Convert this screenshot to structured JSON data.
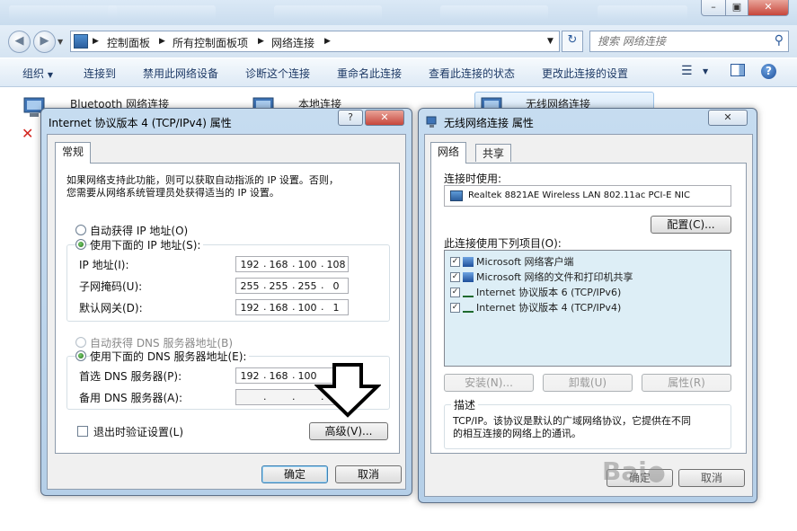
{
  "address": {
    "crumbs": [
      "控制面板",
      "所有控制面板项",
      "网络连接"
    ],
    "search_placeholder": "搜索 网络连接"
  },
  "commands": {
    "organize": "组织",
    "connect_to": "连接到",
    "disable": "禁用此网络设备",
    "diagnose": "诊断这个连接",
    "rename": "重命名此连接",
    "view_status": "查看此连接的状态",
    "change_settings": "更改此连接的设置"
  },
  "connections": [
    {
      "label": "Bluetooth 网络连接"
    },
    {
      "label": "本地连接"
    },
    {
      "label": "无线网络连接"
    }
  ],
  "ipv4_dialog": {
    "title": "Internet 协议版本 4 (TCP/IPv4) 属性",
    "tab": "常规",
    "intro_line1": "如果网络支持此功能，则可以获取自动指派的 IP 设置。否则，",
    "intro_line2": "您需要从网络系统管理员处获得适当的 IP 设置。",
    "auto_ip": "自动获得 IP 地址(O)",
    "manual_ip": "使用下面的 IP 地址(S):",
    "ip_label": "IP 地址(I):",
    "ip_octets": [
      "192",
      "168",
      "100",
      "108"
    ],
    "mask_label": "子网掩码(U):",
    "mask_octets": [
      "255",
      "255",
      "255",
      "0"
    ],
    "gateway_label": "默认网关(D):",
    "gateway_octets": [
      "192",
      "168",
      "100",
      "1"
    ],
    "auto_dns": "自动获得 DNS 服务器地址(B)",
    "manual_dns": "使用下面的 DNS 服务器地址(E):",
    "pref_dns_label": "首选 DNS 服务器(P):",
    "pref_dns_octets": [
      "192",
      "168",
      "100",
      ""
    ],
    "alt_dns_label": "备用 DNS 服务器(A):",
    "validate": "退出时验证设置(L)",
    "advanced": "高级(V)...",
    "ok": "确定",
    "cancel": "取消",
    "help_glyph": "?",
    "close_glyph": "✕"
  },
  "wireless_dialog": {
    "title": "无线网络连接 属性",
    "tab_network": "网络",
    "tab_share": "共享",
    "connect_using": "连接时使用:",
    "adapter": "Realtek 8821AE Wireless LAN 802.11ac PCI-E NIC",
    "configure": "配置(C)...",
    "items_label": "此连接使用下列项目(O):",
    "items": [
      {
        "label": "Microsoft 网络客户端",
        "checked": true
      },
      {
        "label": "Microsoft 网络的文件和打印机共享",
        "checked": true
      },
      {
        "label": "Internet 协议版本 6 (TCP/IPv6)",
        "checked": true
      },
      {
        "label": "Internet 协议版本 4 (TCP/IPv4)",
        "checked": true
      }
    ],
    "install": "安装(N)...",
    "uninstall": "卸载(U)",
    "properties": "属性(R)",
    "desc_title": "描述",
    "desc_line1": "TCP/IP。该协议是默认的广域网络协议，它提供在不同",
    "desc_line2": "的相互连接的网络上的通讯。",
    "ok_partial": "确定",
    "cancel_partial": "取消",
    "close_glyph": "✕"
  },
  "colors": {
    "accent": "#1e3a66",
    "dialog_frame": "#b5cfe8",
    "close_red": "#c7463b"
  },
  "icons": [
    "back-arrow-icon",
    "forward-arrow-icon",
    "search-icon",
    "refresh-icon",
    "help-icon",
    "network-icon",
    "down-arrow-icon",
    "red-x-icon"
  ]
}
